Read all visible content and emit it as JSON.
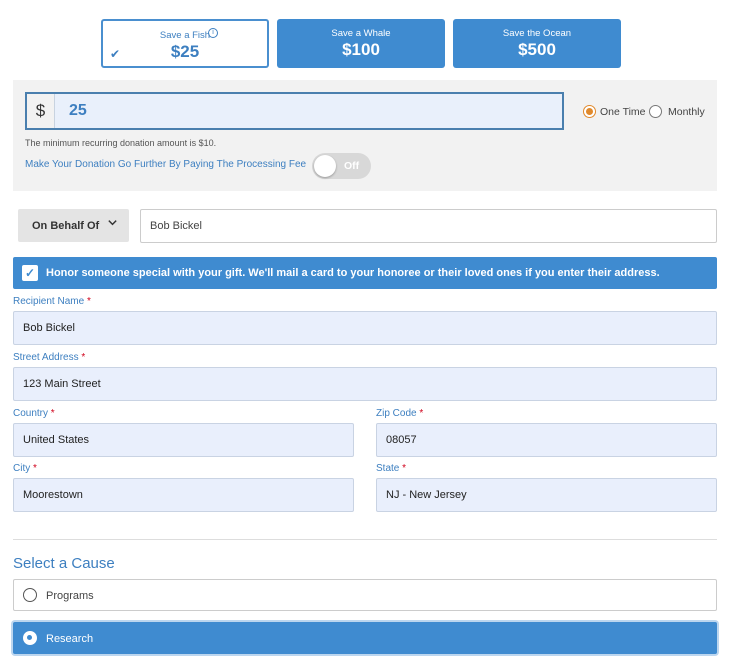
{
  "amount_tiles": [
    {
      "label": "Save a Fish",
      "amount": "$25",
      "selected": true
    },
    {
      "label": "Save a Whale",
      "amount": "$100",
      "selected": false
    },
    {
      "label": "Save the Ocean",
      "amount": "$500",
      "selected": false
    }
  ],
  "icons": {
    "info": "info-icon",
    "check": "checkmark-icon",
    "chevron": "chevron-down-icon"
  },
  "amount": {
    "currency_symbol": "$",
    "value": "25"
  },
  "frequency": {
    "options": [
      "One Time",
      "Monthly"
    ],
    "selected": "One Time"
  },
  "min_note": "The minimum recurring donation amount is $10.",
  "processing_fee": {
    "label": "Make Your Donation Go Further By Paying The Processing Fee",
    "toggle_state": "Off"
  },
  "behalf": {
    "dropdown_label": "On Behalf Of",
    "name_value": "Bob Bickel"
  },
  "honor": {
    "checked": true,
    "text": "Honor someone special with your gift. We'll mail a card to your honoree or their loved ones if you enter their address."
  },
  "fields": {
    "recipient_name": {
      "label": "Recipient Name",
      "value": "Bob Bickel"
    },
    "street_address": {
      "label": "Street Address",
      "value": "123 Main Street"
    },
    "country": {
      "label": "Country",
      "value": "United States"
    },
    "zip_code": {
      "label": "Zip Code",
      "value": "08057"
    },
    "city": {
      "label": "City",
      "value": "Moorestown"
    },
    "state": {
      "label": "State",
      "value": "NJ - New Jersey"
    },
    "required_marker": "*"
  },
  "cause": {
    "title": "Select a Cause",
    "options": [
      {
        "label": "Programs",
        "selected": false
      },
      {
        "label": "Research",
        "selected": true
      }
    ]
  },
  "colors": {
    "accent": "#3f8bd0",
    "radio_selected": "#e0892c",
    "required": "#d0021b",
    "field_bg": "#e9effc"
  }
}
